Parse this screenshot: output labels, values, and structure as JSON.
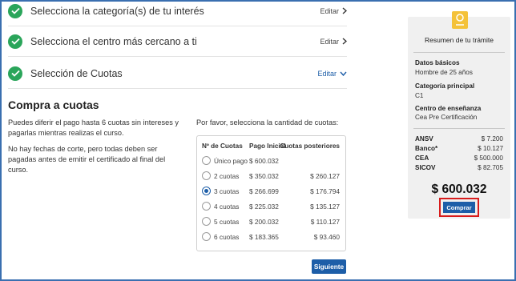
{
  "steps": [
    {
      "title": "Selecciona la categoría(s) de tu interés",
      "edit_label": "Editar",
      "expanded": false
    },
    {
      "title": "Selecciona el centro más cercano a ti",
      "edit_label": "Editar",
      "expanded": false
    },
    {
      "title": "Selección de Cuotas",
      "edit_label": "Editar",
      "expanded": true
    }
  ],
  "section": {
    "title": "Compra a cuotas",
    "para1": "Puedes diferir el pago hasta 6 cuotas sin intereses y pagarlas mientras realizas el curso.",
    "para2": "No hay fechas de corte, pero todas deben ser pagadas antes de emitir el certificado al final del curso.",
    "instruction": "Por favor, selecciona la cantidad de cuotas:"
  },
  "table": {
    "headers": [
      "Nº de Cuotas",
      "Pago Inicial",
      "Cuotas posteriores"
    ],
    "rows": [
      {
        "label": "Único pago",
        "initial": "$ 600.032",
        "later": "",
        "selected": false
      },
      {
        "label": "2 cuotas",
        "initial": "$ 350.032",
        "later": "$ 260.127",
        "selected": false
      },
      {
        "label": "3 cuotas",
        "initial": "$ 266.699",
        "later": "$ 176.794",
        "selected": true
      },
      {
        "label": "4 cuotas",
        "initial": "$ 225.032",
        "later": "$ 135.127",
        "selected": false
      },
      {
        "label": "5 cuotas",
        "initial": "$ 200.032",
        "later": "$ 110.127",
        "selected": false
      },
      {
        "label": "6 cuotas",
        "initial": "$ 183.365",
        "later": "$ 93.460",
        "selected": false
      }
    ]
  },
  "next_label": "Siguiente",
  "summary": {
    "title": "Resumen de tu trámite",
    "basic_label": "Datos básicos",
    "basic_value": "Hombre de 25 años",
    "category_label": "Categoría principal",
    "category_value": "C1",
    "center_label": "Centro de enseñanza",
    "center_value": "Cea Pre Certificación",
    "costs": [
      {
        "k": "ANSV",
        "v": "$ 7.200"
      },
      {
        "k": "Banco*",
        "v": "$ 10.127"
      },
      {
        "k": "CEA",
        "v": "$ 500.000"
      },
      {
        "k": "SICOV",
        "v": "$ 82.705"
      }
    ],
    "total": "$ 600.032",
    "buy_label": "Comprar"
  },
  "colors": {
    "accent": "#1d5ea8",
    "check": "#2aa55a",
    "highlight": "#d81c1c",
    "badge": "#f4c23a"
  },
  "icons": {
    "step": "check-circle-icon",
    "edit_collapsed": "chevron-right-icon",
    "edit_expanded": "chevron-down-icon",
    "badge": "certificate-badge-icon"
  }
}
